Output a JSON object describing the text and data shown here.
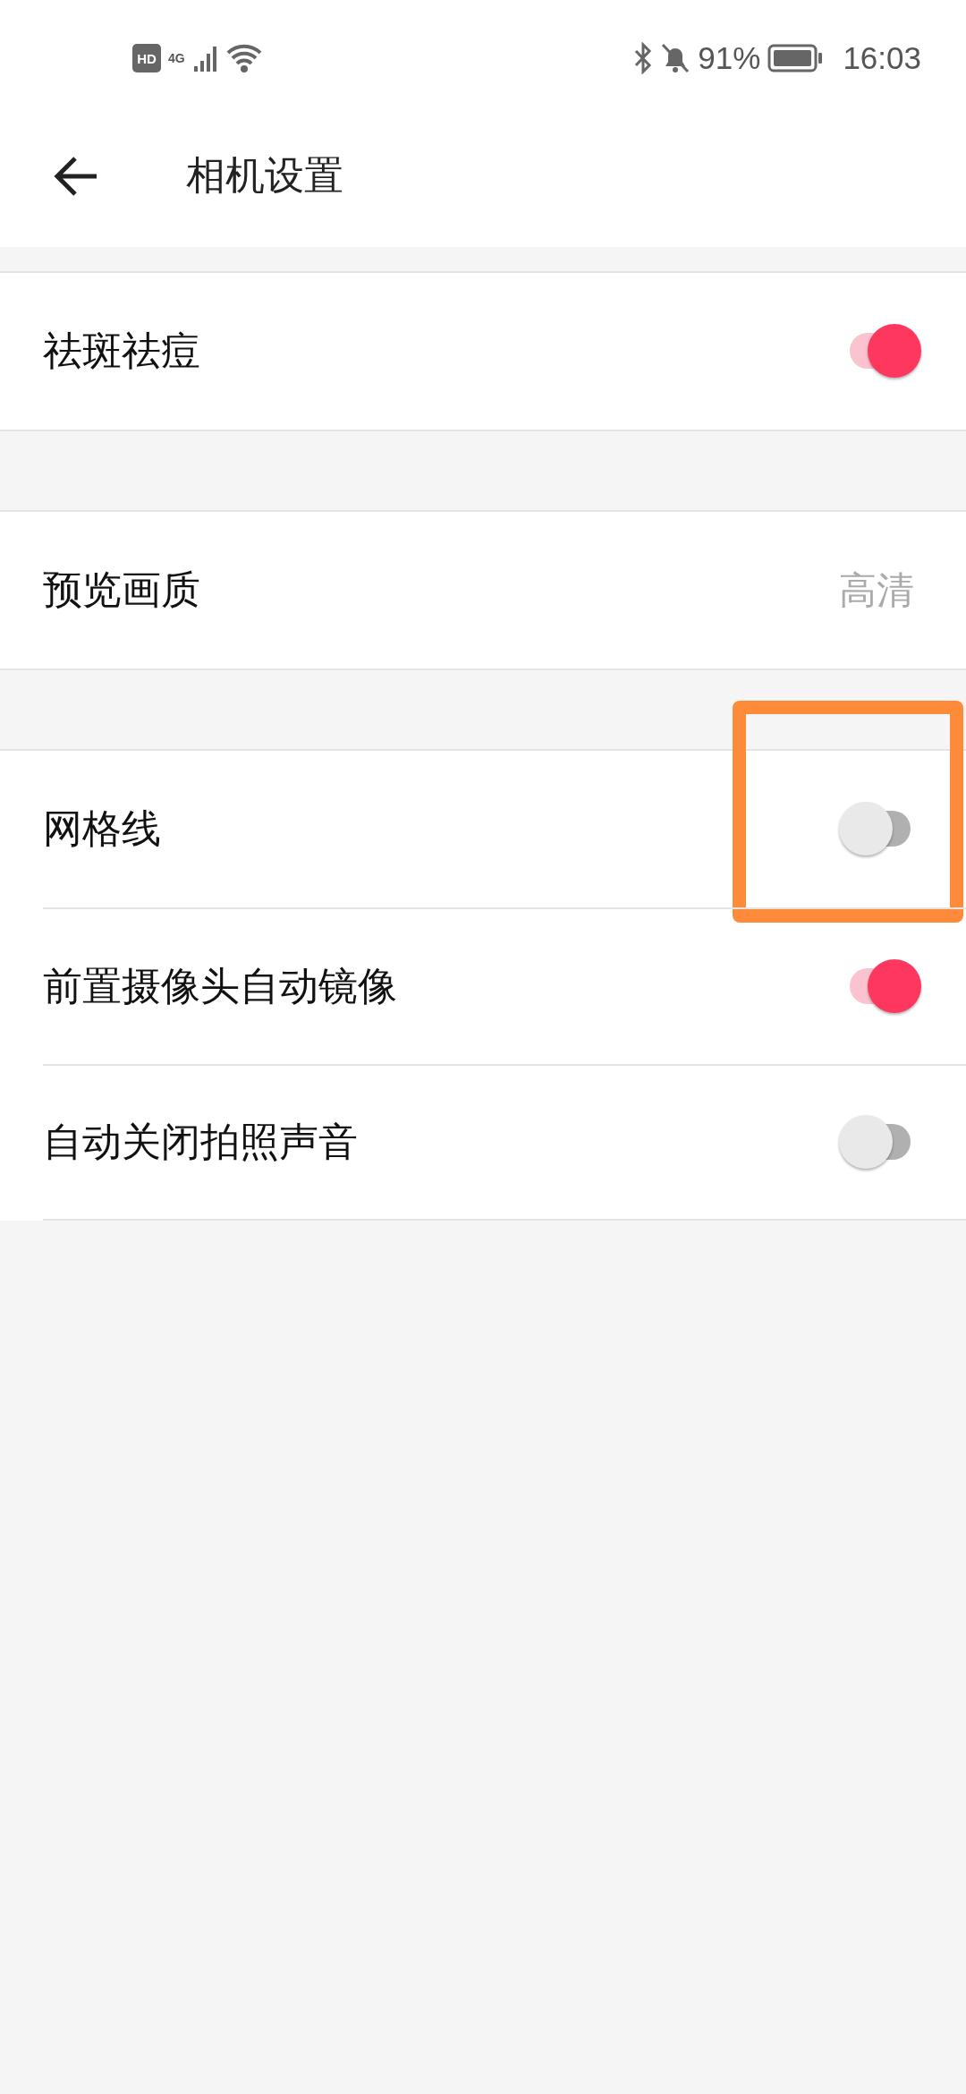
{
  "status_bar": {
    "battery_text": "91%",
    "time": "16:03",
    "network_label": "4G",
    "hd_label": "HD"
  },
  "header": {
    "title": "相机设置"
  },
  "sections": [
    {
      "rows": [
        {
          "kind": "toggle",
          "label": "祛斑祛痘",
          "on": true,
          "highlighted": false
        }
      ]
    },
    {
      "rows": [
        {
          "kind": "value",
          "label": "预览画质",
          "value": "高清",
          "highlighted": false
        }
      ]
    },
    {
      "rows": [
        {
          "kind": "toggle",
          "label": "网格线",
          "on": false,
          "highlighted": true
        },
        {
          "kind": "toggle",
          "label": "前置摄像头自动镜像",
          "on": true,
          "highlighted": false
        },
        {
          "kind": "toggle",
          "label": "自动关闭拍照声音",
          "on": false,
          "highlighted": false
        }
      ]
    }
  ]
}
